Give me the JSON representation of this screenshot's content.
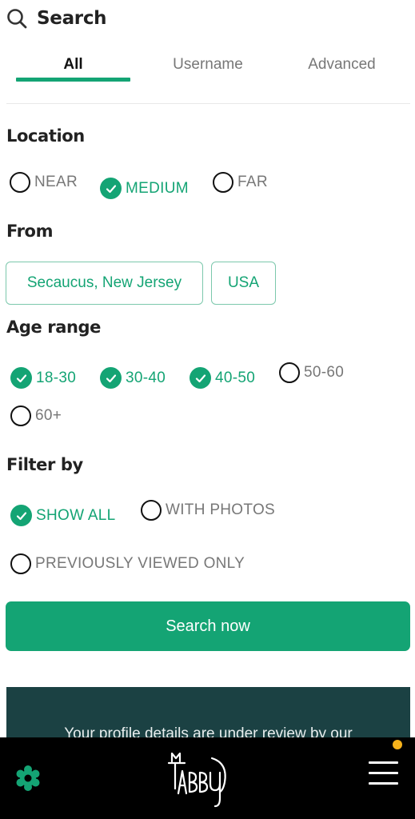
{
  "header": {
    "title": "Search",
    "icon": "search-icon"
  },
  "tabs": [
    {
      "label": "All",
      "active": true
    },
    {
      "label": "Username",
      "active": false
    },
    {
      "label": "Advanced",
      "active": false
    }
  ],
  "location": {
    "title": "Location",
    "options": [
      {
        "label": "NEAR",
        "checked": false
      },
      {
        "label": "MEDIUM",
        "checked": true
      },
      {
        "label": "FAR",
        "checked": false
      }
    ]
  },
  "from": {
    "title": "From",
    "city": "Secaucus, New Jersey",
    "country": "USA"
  },
  "age_range": {
    "title": "Age range",
    "options": [
      {
        "label": "18-30",
        "checked": true
      },
      {
        "label": "30-40",
        "checked": true
      },
      {
        "label": "40-50",
        "checked": true
      },
      {
        "label": "50-60",
        "checked": false
      },
      {
        "label": "60+",
        "checked": false
      }
    ]
  },
  "filter_by": {
    "title": "Filter by",
    "options": [
      {
        "label": "SHOW ALL",
        "checked": true
      },
      {
        "label": "WITH PHOTOS",
        "checked": false
      },
      {
        "label": "PREVIOUSLY VIEWED ONLY",
        "checked": false
      }
    ]
  },
  "search_button": {
    "label": "Search now"
  },
  "review_notice": {
    "text": "Your profile details are under review by our"
  },
  "bottom_nav": {
    "logo_text": "TABBY",
    "left_icon": "gear-icon",
    "right_icon": "menu-icon",
    "notification_dot": true
  },
  "colors": {
    "accent": "#14a474",
    "notice_bg": "#1b4143",
    "nav_bg": "#000000",
    "notification": "#f6b21b"
  }
}
